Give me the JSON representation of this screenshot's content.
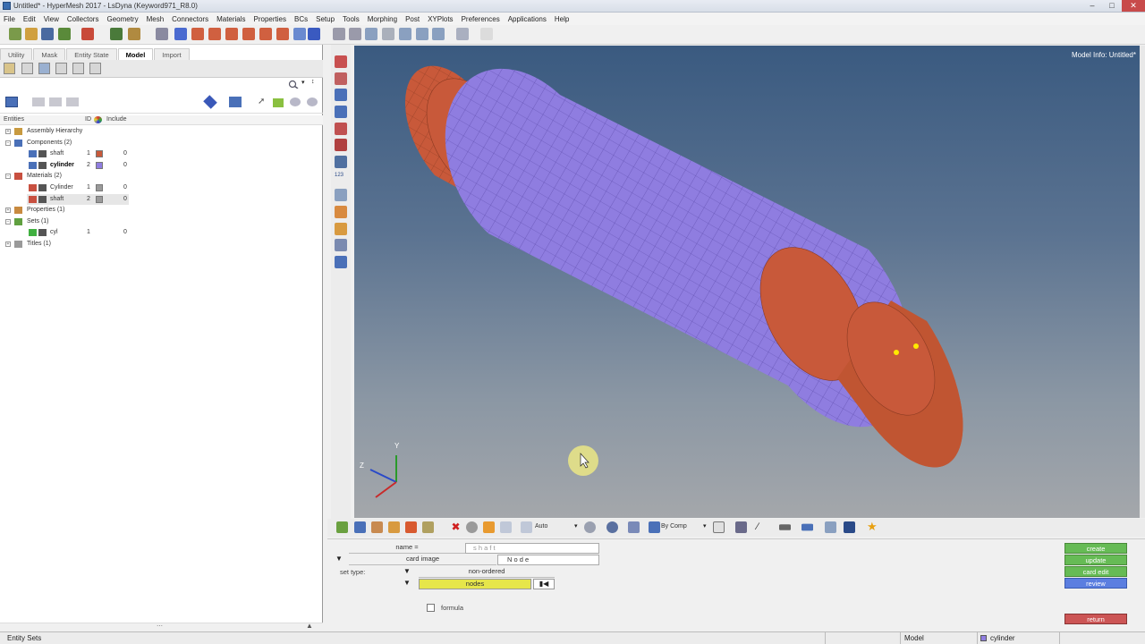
{
  "window": {
    "title": "Untitled* - HyperMesh 2017 - LsDyna (Keyword971_R8.0)"
  },
  "menu": [
    "File",
    "Edit",
    "View",
    "Collectors",
    "Geometry",
    "Mesh",
    "Connectors",
    "Materials",
    "Properties",
    "BCs",
    "Setup",
    "Tools",
    "Morphing",
    "Post",
    "XYPlots",
    "Preferences",
    "Applications",
    "Help"
  ],
  "tabs": [
    "Utility",
    "Mask",
    "Entity State",
    "Model",
    "Import"
  ],
  "active_tab": "Model",
  "browser": {
    "columns": {
      "entities": "Entities",
      "id": "ID",
      "include": "Include"
    },
    "tree": [
      {
        "label": "Assembly Hierarchy",
        "level": 0,
        "id": "",
        "include": "",
        "color": "",
        "bold": false,
        "icon": "assembly-icon"
      },
      {
        "label": "Components (2)",
        "level": 0,
        "id": "",
        "include": "",
        "color": "",
        "bold": false,
        "icon": "components-icon"
      },
      {
        "label": "shaft",
        "level": 2,
        "id": "1",
        "include": "0",
        "color": "#c8593a",
        "bold": false,
        "icon": "component-icon"
      },
      {
        "label": "cylinder",
        "level": 2,
        "id": "2",
        "include": "0",
        "color": "#8f7de0",
        "bold": true,
        "icon": "component-icon"
      },
      {
        "label": "Materials (2)",
        "level": 0,
        "id": "",
        "include": "",
        "color": "",
        "bold": false,
        "icon": "materials-icon"
      },
      {
        "label": "Cylinder",
        "level": 2,
        "id": "1",
        "include": "0",
        "color": "#9a9a9a",
        "bold": false,
        "icon": "material-icon"
      },
      {
        "label": "shaft",
        "level": 2,
        "id": "2",
        "include": "0",
        "color": "#9a9a9a",
        "bold": false,
        "icon": "material-icon",
        "highlight": true
      },
      {
        "label": "Properties (1)",
        "level": 0,
        "id": "",
        "include": "",
        "color": "",
        "bold": false,
        "icon": "properties-icon"
      },
      {
        "label": "Sets (1)",
        "level": 0,
        "id": "",
        "include": "",
        "color": "",
        "bold": false,
        "icon": "sets-icon"
      },
      {
        "label": "cyl",
        "level": 2,
        "id": "1",
        "include": "0",
        "color": "",
        "bold": false,
        "icon": "set-icon"
      },
      {
        "label": "Titles (1)",
        "level": 0,
        "id": "",
        "include": "",
        "color": "",
        "bold": false,
        "icon": "titles-icon"
      }
    ]
  },
  "viewport": {
    "model_info": "Model Info: Untitled*",
    "axis_labels": {
      "y": "Y",
      "z": "Z"
    }
  },
  "view_toolbar": {
    "auto_label": "Auto",
    "by_comp_label": "By Comp"
  },
  "panel": {
    "name_label": "name =",
    "name_value": "s h a f t",
    "card_image_label": "card image",
    "card_image_value": "N o d e",
    "set_type_label": "set type:",
    "set_type_value": "non-ordered",
    "entity_value": "nodes",
    "formula_label": "formula",
    "buttons": [
      "create",
      "update",
      "card edit",
      "review"
    ],
    "return_label": "return"
  },
  "status": {
    "left": "Entity Sets",
    "mode": "Model",
    "component": "cylinder"
  },
  "colors": {
    "shaft": "#c8593a",
    "cylinder": "#8f7de0",
    "create": "#66bb55",
    "review": "#5b7ee0",
    "return": "#cc5555"
  }
}
